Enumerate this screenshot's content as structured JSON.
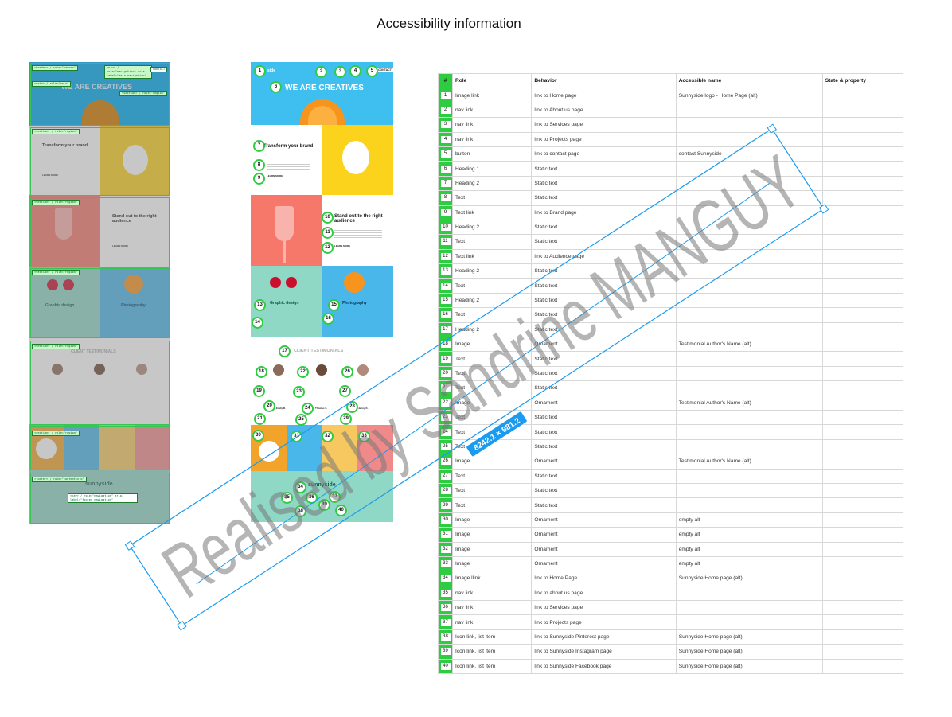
{
  "title": "Accessibility information",
  "left_mock": {
    "tags": {
      "header": "<header> / role=\"banner\"",
      "nav_main": "<nav> / role=\"navigation\" aria-label=\"main navigation\"",
      "nav_btn": "CONTACT",
      "main": "<main> / role=\"main\"",
      "section1": "<section> / role=\"region\"",
      "section2": "<section> / role=\"region\"",
      "section3": "<section> / role=\"region\"",
      "section4": "<section> / role=\"region\"",
      "section5": "<section> / role=\"region\"",
      "section6": "<section> / role=\"region\"",
      "footer": "<footer> / role=\"contentinfo\"",
      "nav_footer": "<nav> / role=\"navigation\" aria-label=\"footer navigation\""
    },
    "hero": "WE ARE CREATIVES",
    "h_transform": "Transform your brand",
    "h_standout": "Stand out to the right audience",
    "learn_more": "LEARN MORE",
    "h_graphic": "Graphic design",
    "h_photo": "Photography",
    "h_testimonials": "CLIENT TESTIMONIALS",
    "footer_logo": "sunnyside"
  },
  "mid_mock": {
    "logo": "side",
    "contact": "CONTACT",
    "hero": "WE ARE CREATIVES",
    "h_transform": "Transform your brand",
    "h_standout": "Stand out to the right audience",
    "learn_more": "LEARN MORE",
    "h_graphic": "Graphic design",
    "h_photo": "Photography",
    "h_testimonials": "CLIENT TESTIMONIALS",
    "footer_logo": "sunnyside",
    "names": [
      "Emily R.",
      "Thomas S.",
      "Jenny K."
    ]
  },
  "table": {
    "headers": [
      "#",
      "Role",
      "Behavior",
      "Accessible name",
      "State & property"
    ],
    "rows": [
      [
        "1",
        "Image link",
        "link to Home page",
        "Sunnyside logo - Home Page (alt)",
        ""
      ],
      [
        "2",
        "nav link",
        "link to About us page",
        "",
        ""
      ],
      [
        "3",
        "nav link",
        "link to Services page",
        "",
        ""
      ],
      [
        "4",
        "nav link",
        "link to Projects page",
        "",
        ""
      ],
      [
        "5",
        "button",
        "link to contact page",
        "contact Sunnyside",
        ""
      ],
      [
        "6",
        "Heading 1",
        "Static text",
        "",
        ""
      ],
      [
        "7",
        "Heading 2",
        "Static text",
        "",
        ""
      ],
      [
        "8",
        "Text",
        "Static text",
        "",
        ""
      ],
      [
        "9",
        "Text link",
        "link to Brand page",
        "",
        ""
      ],
      [
        "10",
        "Heading 2",
        "Static text",
        "",
        ""
      ],
      [
        "11",
        "Text",
        "Static text",
        "",
        ""
      ],
      [
        "12",
        "Text link",
        "link to Audience page",
        "",
        ""
      ],
      [
        "13",
        "Heading 2",
        "Static text",
        "",
        ""
      ],
      [
        "14",
        "Text",
        "Static text",
        "",
        ""
      ],
      [
        "15",
        "Heading 2",
        "Static text",
        "",
        ""
      ],
      [
        "16",
        "Text",
        "Static text",
        "",
        ""
      ],
      [
        "17",
        "Heading 2",
        "Static text",
        "",
        ""
      ],
      [
        "18",
        "Image",
        "Ornament",
        "Testimonial Author's Name (alt)",
        ""
      ],
      [
        "19",
        "Text",
        "Static text",
        "",
        ""
      ],
      [
        "20",
        "Text",
        "Static text",
        "",
        ""
      ],
      [
        "21",
        "Text",
        "Static text",
        "",
        ""
      ],
      [
        "22",
        "Image",
        "Ornament",
        "Testimonial Author's Name (alt)",
        ""
      ],
      [
        "23",
        "Text",
        "Static text",
        "",
        ""
      ],
      [
        "24",
        "Text",
        "Static text",
        "",
        ""
      ],
      [
        "25",
        "Text",
        "Static text",
        "",
        ""
      ],
      [
        "26",
        "Image",
        "Ornament",
        "Testimonial Author's Name (alt)",
        ""
      ],
      [
        "27",
        "Text",
        "Static text",
        "",
        ""
      ],
      [
        "28",
        "Text",
        "Static text",
        "",
        ""
      ],
      [
        "29",
        "Text",
        "Static text",
        "",
        ""
      ],
      [
        "30",
        "Image",
        "Ornament",
        "empty alt",
        ""
      ],
      [
        "31",
        "Image",
        "Ornament",
        "empty alt",
        ""
      ],
      [
        "32",
        "Image",
        "Ornament",
        "empty alt",
        ""
      ],
      [
        "33",
        "Image",
        "Ornament",
        "empty alt",
        ""
      ],
      [
        "34",
        "Image llink",
        "link to Home Page",
        "Sunnyside Home page (alt)",
        ""
      ],
      [
        "35",
        "nav link",
        "link to about us page",
        "",
        ""
      ],
      [
        "36",
        "nav link",
        "link to Services page",
        "",
        ""
      ],
      [
        "37",
        "nav link",
        "link to Projects page",
        "",
        ""
      ],
      [
        "38",
        "Icon link, list item",
        "link to Sunnyside  Pinterest page",
        "Sunnyside Home page (alt)",
        ""
      ],
      [
        "39",
        "Icon link, list item",
        " link to Sunnyside  Instagram page",
        "Sunnyside Home page (alt)",
        ""
      ],
      [
        "40",
        "Icon link, list item",
        " link to Sunnyside  Facebook page",
        "Sunnyside Home page (alt)",
        ""
      ]
    ]
  },
  "watermark": "Realised by Sandrine MANGUY",
  "selection_size": "8242.1 × 981.2",
  "colors": {
    "accent_green": "#2ecc40",
    "selection_blue": "#1a9bf0",
    "hero_blue": "#3ebfef",
    "yellow": "#fbd21c",
    "coral": "#f5786b",
    "teal": "#8fd8c6"
  }
}
